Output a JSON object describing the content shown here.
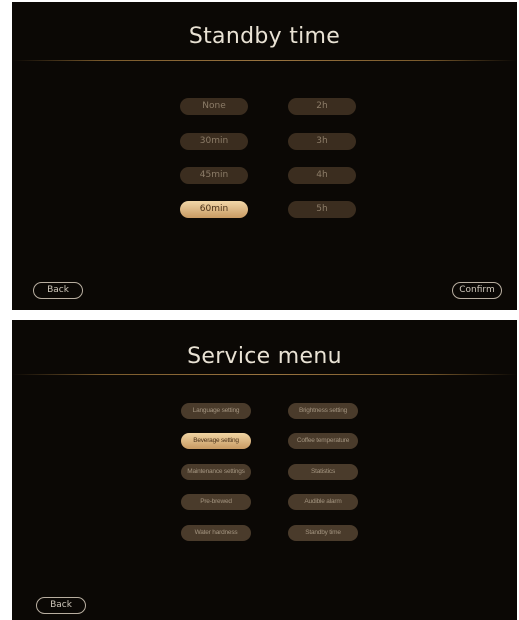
{
  "standby_screen": {
    "title": "Standby time",
    "options_left": [
      {
        "label": "None",
        "selected": false
      },
      {
        "label": "30min",
        "selected": false
      },
      {
        "label": "45min",
        "selected": false
      },
      {
        "label": "60min",
        "selected": true
      }
    ],
    "options_right": [
      {
        "label": "2h",
        "selected": false
      },
      {
        "label": "3h",
        "selected": false
      },
      {
        "label": "4h",
        "selected": false
      },
      {
        "label": "5h",
        "selected": false
      }
    ],
    "back_label": "Back",
    "confirm_label": "Confirm"
  },
  "service_screen": {
    "title": "Service menu",
    "items_left": [
      {
        "label": "Language setting",
        "selected": false
      },
      {
        "label": "Beverage setting",
        "selected": true
      },
      {
        "label": "Maintenance settings",
        "selected": false
      },
      {
        "label": "Pre-brewed",
        "selected": false
      },
      {
        "label": "Water hardness",
        "selected": false
      }
    ],
    "items_right": [
      {
        "label": "Brightness setting",
        "selected": false
      },
      {
        "label": "Coffee temperature",
        "selected": false
      },
      {
        "label": "Statistics",
        "selected": false
      },
      {
        "label": "Audible alarm",
        "selected": false
      },
      {
        "label": "Standby time",
        "selected": false
      }
    ],
    "back_label": "Back"
  },
  "colors": {
    "panel_background": "#0b0805",
    "button_inactive": "#3b2d1f",
    "button_selected": "#d9b07a",
    "divider_gold": "#9a7440"
  }
}
